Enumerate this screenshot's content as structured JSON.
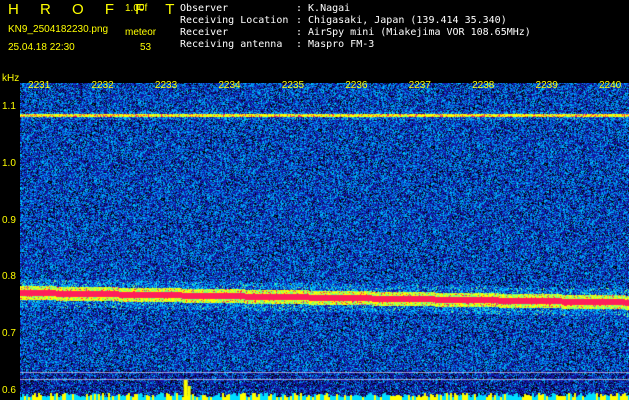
{
  "header": {
    "app_title": "H R O F F T",
    "version": "1.00f",
    "filename": "KN9_2504182230.png",
    "datetime": "25.04.18 22:30",
    "meteor_label": "meteor",
    "meteor_count": "53"
  },
  "info": [
    {
      "key": "Observer",
      "value": ": K.Nagai"
    },
    {
      "key": "Receiving Location",
      "value": ": Chigasaki, Japan (139.414 35.340)"
    },
    {
      "key": "Receiver",
      "value": ": AirSpy mini (Miakejima VOR 108.65MHz)"
    },
    {
      "key": "Receiving antenna",
      "value": ": Maspro FM-3"
    }
  ],
  "chart_data": {
    "type": "heatmap",
    "ylabel": "kHz",
    "x_ticks": [
      "2231",
      "2232",
      "2233",
      "2234",
      "2235",
      "2236",
      "2237",
      "2238",
      "2239",
      "2240"
    ],
    "y_ticks": [
      "1.1",
      "1.0",
      "0.9",
      "0.8",
      "0.7",
      "0.6"
    ],
    "y_tick_values": [
      1.1,
      1.0,
      0.9,
      0.8,
      0.7,
      0.6
    ],
    "ylim": [
      0.585,
      1.145
    ],
    "xlim": [
      2230.7,
      2240.3
    ],
    "x_tick_values": [
      2231,
      2232,
      2233,
      2234,
      2235,
      2236,
      2237,
      2238,
      2239,
      2240
    ],
    "carrier_khz": 1.088,
    "main_signal_khz_start": 0.775,
    "main_signal_khz_end": 0.758,
    "colors": {
      "background": "#000000",
      "labels": "#ffff00",
      "low": "#1a1aa0",
      "mid": "#00b4ff",
      "high": "#ffff00",
      "peak": "#ff2060"
    }
  }
}
